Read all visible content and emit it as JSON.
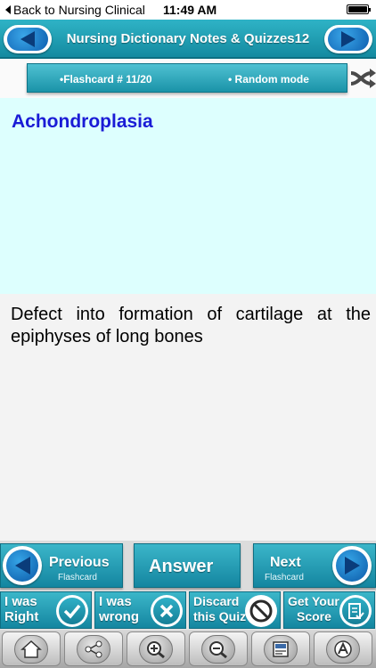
{
  "status_bar": {
    "back_label": "Back to Nursing Clinical",
    "time": "11:49 AM",
    "battery_level": 1.0
  },
  "header": {
    "title": "Nursing Dictionary Notes & Quizzes12",
    "prev_icon": "arrow-left-icon",
    "next_icon": "arrow-right-icon"
  },
  "info_bar": {
    "flashcard_label": "•Flashcard #  11/20",
    "mode_label": "• Random mode",
    "shuffle_icon": "shuffle-icon"
  },
  "card": {
    "term": "Achondroplasia",
    "definition": "Defect into formation of cartilage at the epiphyses of long bones"
  },
  "navigation": {
    "previous": {
      "label": "Previous",
      "sublabel": "Flashcard"
    },
    "answer": {
      "label": "Answer"
    },
    "next": {
      "label": "Next",
      "sublabel": "Flashcard"
    }
  },
  "actions": [
    {
      "line1": "I was",
      "line2": "Right",
      "icon": "check-icon"
    },
    {
      "line1": "I was",
      "line2": "wrong",
      "icon": "x-icon"
    },
    {
      "line1": "Discard",
      "line2": "this Quiz",
      "icon": "prohibit-icon"
    },
    {
      "line1": "Get Your",
      "line2": "Score",
      "icon": "score-icon"
    }
  ],
  "toolbar": [
    "home-icon",
    "share-icon",
    "zoom-in-icon",
    "zoom-out-icon",
    "notes-icon",
    "font-icon"
  ],
  "colors": {
    "accent": "#1a93a8",
    "question_bg": "#ddfffe",
    "term_color": "#1a1bd6"
  }
}
